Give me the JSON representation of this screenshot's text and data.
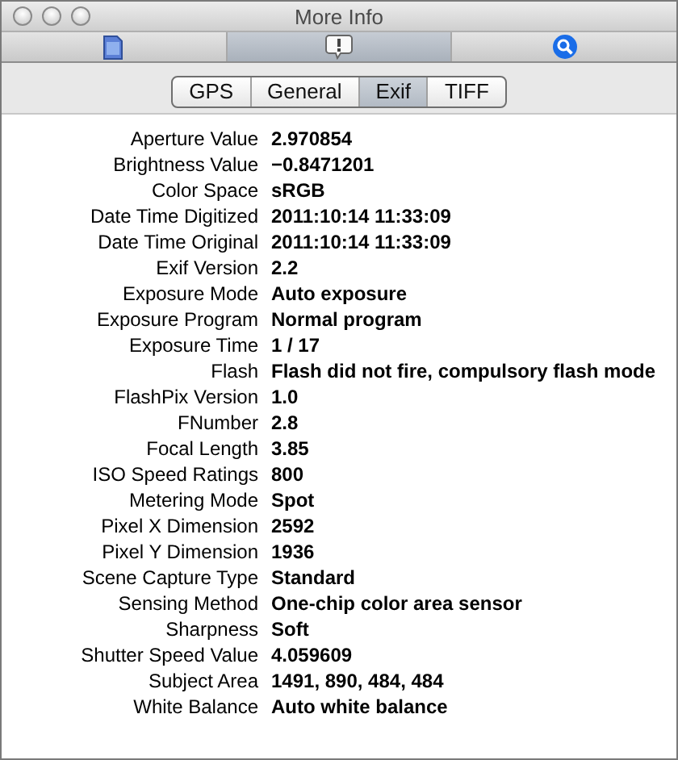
{
  "window": {
    "title": "More Info"
  },
  "toolbar": [
    {
      "kind": "document",
      "selected": false
    },
    {
      "kind": "alert",
      "selected": true
    },
    {
      "kind": "search",
      "selected": false
    }
  ],
  "tabs": [
    {
      "label": "GPS",
      "selected": false
    },
    {
      "label": "General",
      "selected": false
    },
    {
      "label": "Exif",
      "selected": true
    },
    {
      "label": "TIFF",
      "selected": false
    }
  ],
  "properties": [
    {
      "label": "Aperture Value",
      "value": "2.970854"
    },
    {
      "label": "Brightness Value",
      "value": "−0.8471201"
    },
    {
      "label": "Color Space",
      "value": "sRGB"
    },
    {
      "label": "Date Time Digitized",
      "value": "2011:10:14 11:33:09"
    },
    {
      "label": "Date Time Original",
      "value": "2011:10:14 11:33:09"
    },
    {
      "label": "Exif Version",
      "value": "2.2"
    },
    {
      "label": "Exposure Mode",
      "value": "Auto exposure"
    },
    {
      "label": "Exposure Program",
      "value": "Normal program"
    },
    {
      "label": "Exposure Time",
      "value": "1 / 17"
    },
    {
      "label": "Flash",
      "value": "Flash did not fire, compulsory flash mode"
    },
    {
      "label": "FlashPix Version",
      "value": "1.0"
    },
    {
      "label": "FNumber",
      "value": "2.8"
    },
    {
      "label": "Focal Length",
      "value": "3.85"
    },
    {
      "label": "ISO Speed Ratings",
      "value": "800"
    },
    {
      "label": "Metering Mode",
      "value": "Spot"
    },
    {
      "label": "Pixel X Dimension",
      "value": "2592"
    },
    {
      "label": "Pixel Y Dimension",
      "value": "1936"
    },
    {
      "label": "Scene Capture Type",
      "value": "Standard"
    },
    {
      "label": "Sensing Method",
      "value": "One-chip color area sensor"
    },
    {
      "label": "Sharpness",
      "value": "Soft"
    },
    {
      "label": "Shutter Speed Value",
      "value": "4.059609"
    },
    {
      "label": "Subject Area",
      "value": "1491, 890, 484, 484"
    },
    {
      "label": "White Balance",
      "value": "Auto white balance"
    }
  ]
}
